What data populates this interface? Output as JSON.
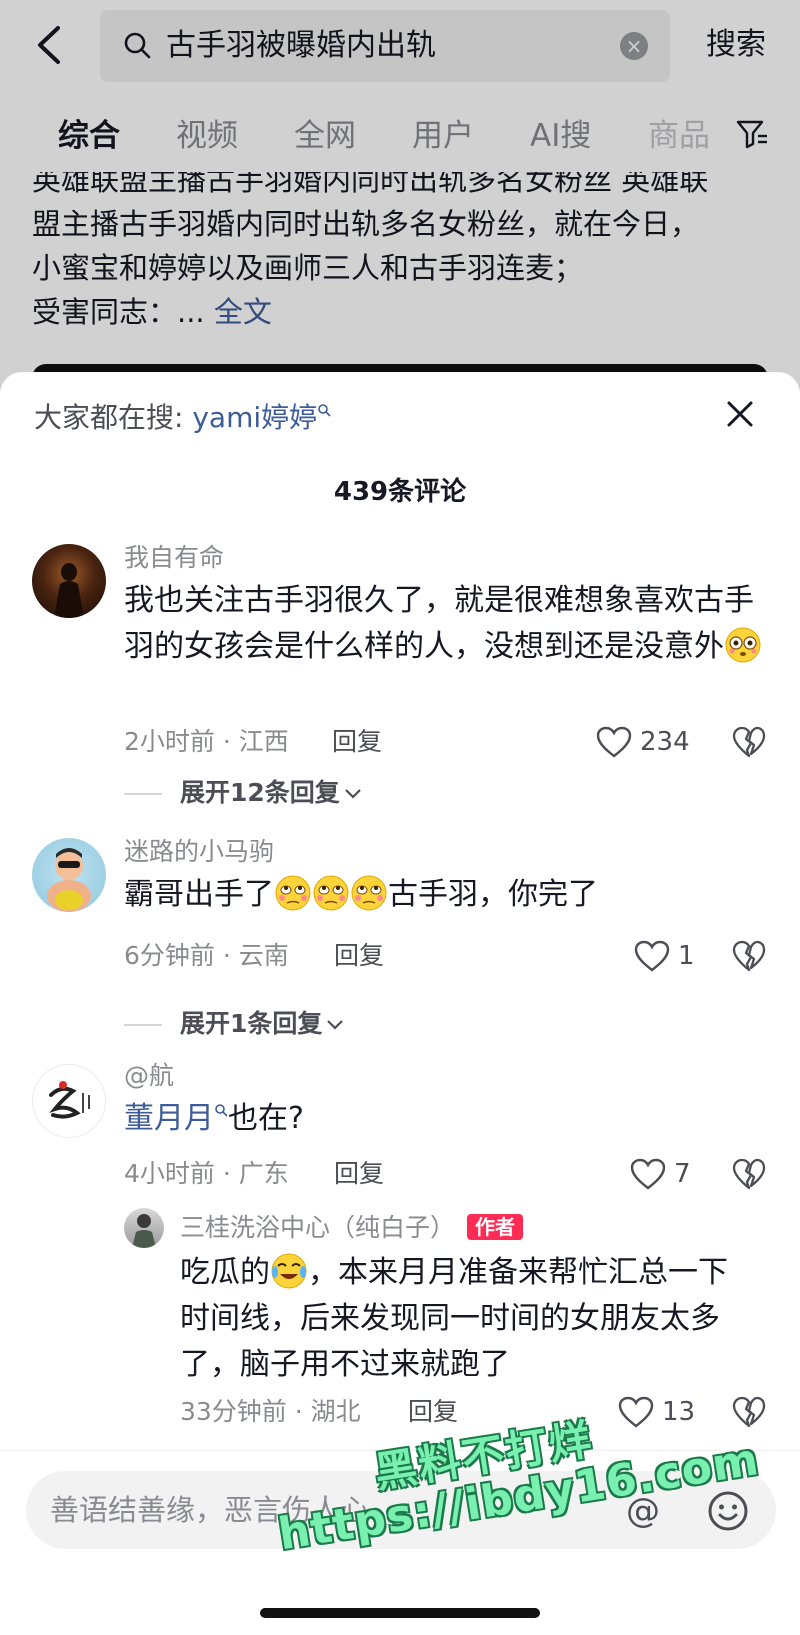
{
  "header": {
    "search_query": "古手羽被曝婚内出轨",
    "search_button": "搜索"
  },
  "tabs": [
    {
      "label": "综合",
      "active": true
    },
    {
      "label": "视频",
      "active": false
    },
    {
      "label": "全网",
      "active": false
    },
    {
      "label": "用户",
      "active": false
    },
    {
      "label": "AI搜",
      "active": false
    },
    {
      "label": "商品",
      "active": false
    }
  ],
  "post": {
    "line1": "英雄联盟主播古手羽婚内同时出轨多名女粉丝 英雄联",
    "line2": "盟主播古手羽婚内同时出轨多名女粉丝，就在今日，",
    "line3": "小蜜宝和婷婷以及画师三人和古手羽连麦；",
    "line4_prefix": "受害同志：... ",
    "full_text_link": "全文"
  },
  "sheet": {
    "hot_search_prefix": "大家都在搜: ",
    "hot_search_keyword": "yami婷婷",
    "comment_count": "439条评论"
  },
  "comments": [
    {
      "user": "我自有命",
      "body": "我也关注古手羽很久了，就是很难想象喜欢古手羽的女孩会是什么样的人，没想到还是没意外",
      "meta": "2小时前 · 江西",
      "reply": "回复",
      "likes": "234",
      "expand": "展开12条回复"
    },
    {
      "user": "迷路的小马驹",
      "body_prefix": "霸哥出手了",
      "body_suffix": "古手羽，你完了",
      "meta": "6分钟前 · 云南",
      "reply": "回复",
      "likes": "1",
      "expand": "展开1条回复"
    },
    {
      "user": "@航",
      "body_link": "董月月",
      "body_suffix": "也在?",
      "meta": "4小时前 · 广东",
      "reply": "回复",
      "likes": "7"
    }
  ],
  "sub_reply": {
    "user": "三桂洗浴中心（纯白子）",
    "badge": "作者",
    "body_prefix": "吃瓜的",
    "body_line1_rest": "，本来月月准备来帮忙汇总一下",
    "body_line2": "时间线，后来发现同一时间的女朋友太多",
    "body_line3": "了，脑子用不过来就跑了",
    "meta": "33分钟前 · 湖北",
    "reply": "回复",
    "likes": "13"
  },
  "input": {
    "placeholder": "善语结善缘，恶言伤人心"
  },
  "watermark": {
    "line1": "黑料不打烊",
    "line2": "https://ibdy16.com"
  },
  "colors": {
    "link_blue": "#3d5d9a",
    "author_badge": "#fe2c55",
    "secondary_text": "#8a8b91"
  }
}
